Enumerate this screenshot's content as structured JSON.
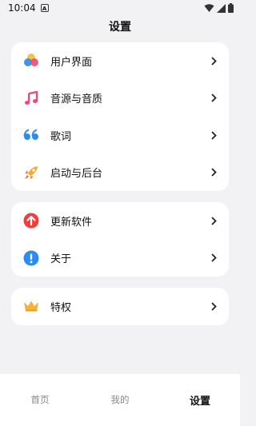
{
  "status": {
    "time": "10:04",
    "notification_letter": "A"
  },
  "header": {
    "title": "设置"
  },
  "group1": [
    {
      "label": "用户界面",
      "icon": "palette-circles-icon"
    },
    {
      "label": "音源与音质",
      "icon": "music-note-icon"
    },
    {
      "label": "歌词",
      "icon": "quote-icon"
    },
    {
      "label": "启动与后台",
      "icon": "rocket-icon"
    }
  ],
  "group2": [
    {
      "label": "更新软件",
      "icon": "update-arrow-icon"
    },
    {
      "label": "关于",
      "icon": "info-icon"
    }
  ],
  "group3": [
    {
      "label": "特权",
      "icon": "crown-icon"
    }
  ],
  "tabs": [
    {
      "label": "首页",
      "active": false
    },
    {
      "label": "我的",
      "active": false
    },
    {
      "label": "设置",
      "active": true
    }
  ],
  "colors": {
    "accent_red": "#f23d3d",
    "accent_blue": "#2b8cf0",
    "crown": "#f7b23b"
  }
}
